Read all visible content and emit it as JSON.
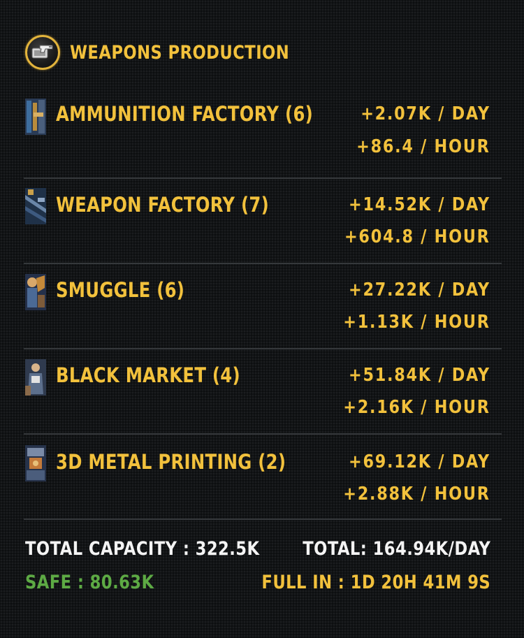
{
  "header": {
    "title": "WEAPONS PRODUCTION",
    "icon": "gun-crate-icon"
  },
  "rows": [
    {
      "name": "AMMUNITION FACTORY (6)",
      "per_day": "+2.07K / DAY",
      "per_hour": "+86.4 / HOUR",
      "thumb": "ammunition-factory-thumbnail"
    },
    {
      "name": "WEAPON FACTORY (7)",
      "per_day": "+14.52K / DAY",
      "per_hour": "+604.8 / HOUR",
      "thumb": "weapon-factory-thumbnail"
    },
    {
      "name": "SMUGGLE (6)",
      "per_day": "+27.22K / DAY",
      "per_hour": "+1.13K / HOUR",
      "thumb": "smuggle-thumbnail"
    },
    {
      "name": "BLACK MARKET (4)",
      "per_day": "+51.84K / DAY",
      "per_hour": "+2.16K / HOUR",
      "thumb": "black-market-thumbnail"
    },
    {
      "name": "3D METAL PRINTING (2)",
      "per_day": "+69.12K / DAY",
      "per_hour": "+2.88K / HOUR",
      "thumb": "3d-metal-printing-thumbnail"
    }
  ],
  "footer": {
    "total_capacity": "TOTAL CAPACITY : 322.5K",
    "safe": "SAFE : 80.63K",
    "total": "TOTAL: 164.94K/DAY",
    "full_in": "FULL IN : 1D 20H 41M 9S"
  },
  "colors": {
    "accent": "#f2c13c",
    "safe": "#5daa44",
    "text": "#f4f4f4",
    "background": "#121416",
    "divider": "#35383b"
  }
}
